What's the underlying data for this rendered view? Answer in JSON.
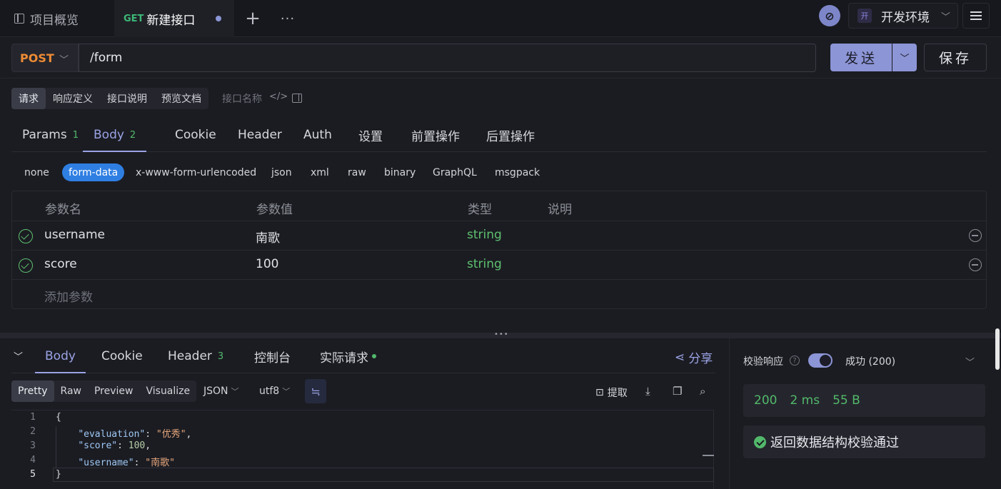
{
  "top_tabs": {
    "overview_label": "项目概览",
    "active_tab": {
      "method": "GET",
      "name": "新建接口"
    },
    "add_label": "+",
    "more_label": "···"
  },
  "environment": {
    "badge": "开",
    "name": "开发环境"
  },
  "request": {
    "method": "POST",
    "url": "/form",
    "send_label": "发送",
    "save_label": "保存"
  },
  "mode_tabs": [
    "请求",
    "响应定义",
    "接口说明",
    "预览文档"
  ],
  "api_name_placeholder": "接口名称",
  "req_tabs": [
    {
      "label": "Params",
      "count": "1"
    },
    {
      "label": "Body",
      "count": "2"
    },
    {
      "label": "Cookie",
      "count": ""
    },
    {
      "label": "Header",
      "count": ""
    },
    {
      "label": "Auth",
      "count": ""
    },
    {
      "label": "设置",
      "count": ""
    },
    {
      "label": "前置操作",
      "count": ""
    },
    {
      "label": "后置操作",
      "count": ""
    }
  ],
  "body_types": [
    "none",
    "form-data",
    "x-www-form-urlencoded",
    "json",
    "xml",
    "raw",
    "binary",
    "GraphQL",
    "msgpack"
  ],
  "param_table": {
    "headers": [
      "参数名",
      "参数值",
      "类型",
      "说明"
    ],
    "rows": [
      {
        "name": "username",
        "value": "南歌",
        "type": "string",
        "desc": ""
      },
      {
        "name": "score",
        "value": "100",
        "type": "string",
        "desc": ""
      }
    ],
    "add_placeholder": "添加参数"
  },
  "response": {
    "tabs": [
      {
        "label": "Body",
        "count": ""
      },
      {
        "label": "Cookie",
        "count": ""
      },
      {
        "label": "Header",
        "count": "3"
      },
      {
        "label": "控制台",
        "count": ""
      },
      {
        "label": "实际请求",
        "count": ""
      }
    ],
    "share_label": "分享",
    "view_tabs": [
      "Pretty",
      "Raw",
      "Preview",
      "Visualize"
    ],
    "format": "JSON",
    "encoding": "utf8",
    "extract_label": "提取",
    "code_lines": [
      {
        "num": "1",
        "text": "{"
      },
      {
        "num": "2",
        "key": "\"evaluation\"",
        "value": "\"优秀\"",
        "value_type": "string"
      },
      {
        "num": "3",
        "key": "\"score\"",
        "value": "100",
        "value_type": "number"
      },
      {
        "num": "4",
        "key": "\"username\"",
        "value": "\"南歌\"",
        "value_type": "string"
      },
      {
        "num": "5",
        "text": "}"
      }
    ]
  },
  "verify": {
    "label": "校验响应",
    "help": "?",
    "enabled": true,
    "status_option": "成功 (200)",
    "status_code": "200",
    "time": "2 ms",
    "size": "55 B",
    "result": "返回数据结构校验通过"
  },
  "colors": {
    "accent": "#8c95d6",
    "success": "#52b96b",
    "method_post": "#ef8c35",
    "method_get": "#3cb878",
    "active_body_type": "#2f7fe3"
  }
}
